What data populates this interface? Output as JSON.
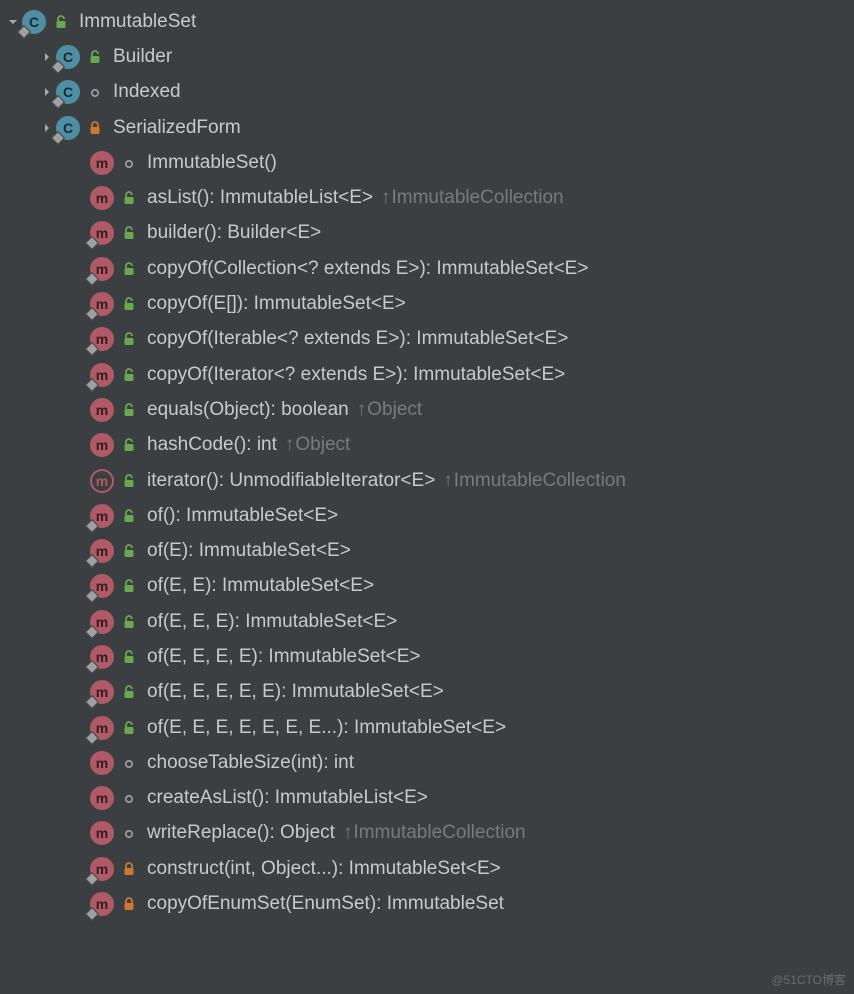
{
  "tree": [
    {
      "indent": 0,
      "arrow": "down",
      "kind": "class",
      "diamond": true,
      "vis": "public",
      "label": "ImmutableSet"
    },
    {
      "indent": 1,
      "arrow": "right",
      "kind": "class",
      "diamond": true,
      "vis": "public",
      "label": "Builder"
    },
    {
      "indent": 1,
      "arrow": "right",
      "kind": "class",
      "diamond": true,
      "vis": "package",
      "label": "Indexed"
    },
    {
      "indent": 1,
      "arrow": "right",
      "kind": "class",
      "diamond": true,
      "vis": "private",
      "label": "SerializedForm"
    },
    {
      "indent": 2,
      "arrow": "none",
      "kind": "method",
      "diamond": false,
      "vis": "package",
      "label": "ImmutableSet()"
    },
    {
      "indent": 2,
      "arrow": "none",
      "kind": "method",
      "diamond": false,
      "vis": "public",
      "label": "asList(): ImmutableList<E>",
      "origin": "ImmutableCollection"
    },
    {
      "indent": 2,
      "arrow": "none",
      "kind": "method",
      "diamond": true,
      "vis": "public",
      "label": "builder(): Builder<E>"
    },
    {
      "indent": 2,
      "arrow": "none",
      "kind": "method",
      "diamond": true,
      "vis": "public",
      "label": "copyOf(Collection<? extends E>): ImmutableSet<E>"
    },
    {
      "indent": 2,
      "arrow": "none",
      "kind": "method",
      "diamond": true,
      "vis": "public",
      "label": "copyOf(E[]): ImmutableSet<E>"
    },
    {
      "indent": 2,
      "arrow": "none",
      "kind": "method",
      "diamond": true,
      "vis": "public",
      "label": "copyOf(Iterable<? extends E>): ImmutableSet<E>"
    },
    {
      "indent": 2,
      "arrow": "none",
      "kind": "method",
      "diamond": true,
      "vis": "public",
      "label": "copyOf(Iterator<? extends E>): ImmutableSet<E>"
    },
    {
      "indent": 2,
      "arrow": "none",
      "kind": "method",
      "diamond": false,
      "vis": "public",
      "label": "equals(Object): boolean",
      "origin": "Object"
    },
    {
      "indent": 2,
      "arrow": "none",
      "kind": "method",
      "diamond": false,
      "vis": "public",
      "label": "hashCode(): int",
      "origin": "Object"
    },
    {
      "indent": 2,
      "arrow": "none",
      "kind": "method-outline",
      "diamond": false,
      "vis": "public",
      "label": "iterator(): UnmodifiableIterator<E>",
      "origin": "ImmutableCollection"
    },
    {
      "indent": 2,
      "arrow": "none",
      "kind": "method",
      "diamond": true,
      "vis": "public",
      "label": "of(): ImmutableSet<E>"
    },
    {
      "indent": 2,
      "arrow": "none",
      "kind": "method",
      "diamond": true,
      "vis": "public",
      "label": "of(E): ImmutableSet<E>"
    },
    {
      "indent": 2,
      "arrow": "none",
      "kind": "method",
      "diamond": true,
      "vis": "public",
      "label": "of(E, E): ImmutableSet<E>"
    },
    {
      "indent": 2,
      "arrow": "none",
      "kind": "method",
      "diamond": true,
      "vis": "public",
      "label": "of(E, E, E): ImmutableSet<E>"
    },
    {
      "indent": 2,
      "arrow": "none",
      "kind": "method",
      "diamond": true,
      "vis": "public",
      "label": "of(E, E, E, E): ImmutableSet<E>"
    },
    {
      "indent": 2,
      "arrow": "none",
      "kind": "method",
      "diamond": true,
      "vis": "public",
      "label": "of(E, E, E, E, E): ImmutableSet<E>"
    },
    {
      "indent": 2,
      "arrow": "none",
      "kind": "method",
      "diamond": true,
      "vis": "public",
      "label": "of(E, E, E, E, E, E, E...): ImmutableSet<E>"
    },
    {
      "indent": 2,
      "arrow": "none",
      "kind": "method",
      "diamond": false,
      "vis": "package",
      "label": "chooseTableSize(int): int"
    },
    {
      "indent": 2,
      "arrow": "none",
      "kind": "method",
      "diamond": false,
      "vis": "package",
      "label": "createAsList(): ImmutableList<E>"
    },
    {
      "indent": 2,
      "arrow": "none",
      "kind": "method",
      "diamond": false,
      "vis": "package",
      "label": "writeReplace(): Object",
      "origin": "ImmutableCollection"
    },
    {
      "indent": 2,
      "arrow": "none",
      "kind": "method",
      "diamond": true,
      "vis": "private",
      "label": "construct(int, Object...): ImmutableSet<E>"
    },
    {
      "indent": 2,
      "arrow": "none",
      "kind": "method",
      "diamond": true,
      "vis": "private",
      "label": "copyOfEnumSet(EnumSet): ImmutableSet"
    }
  ],
  "watermark": "@51CTO博客",
  "icons": {
    "class_letter": "C",
    "method_letter": "m"
  }
}
